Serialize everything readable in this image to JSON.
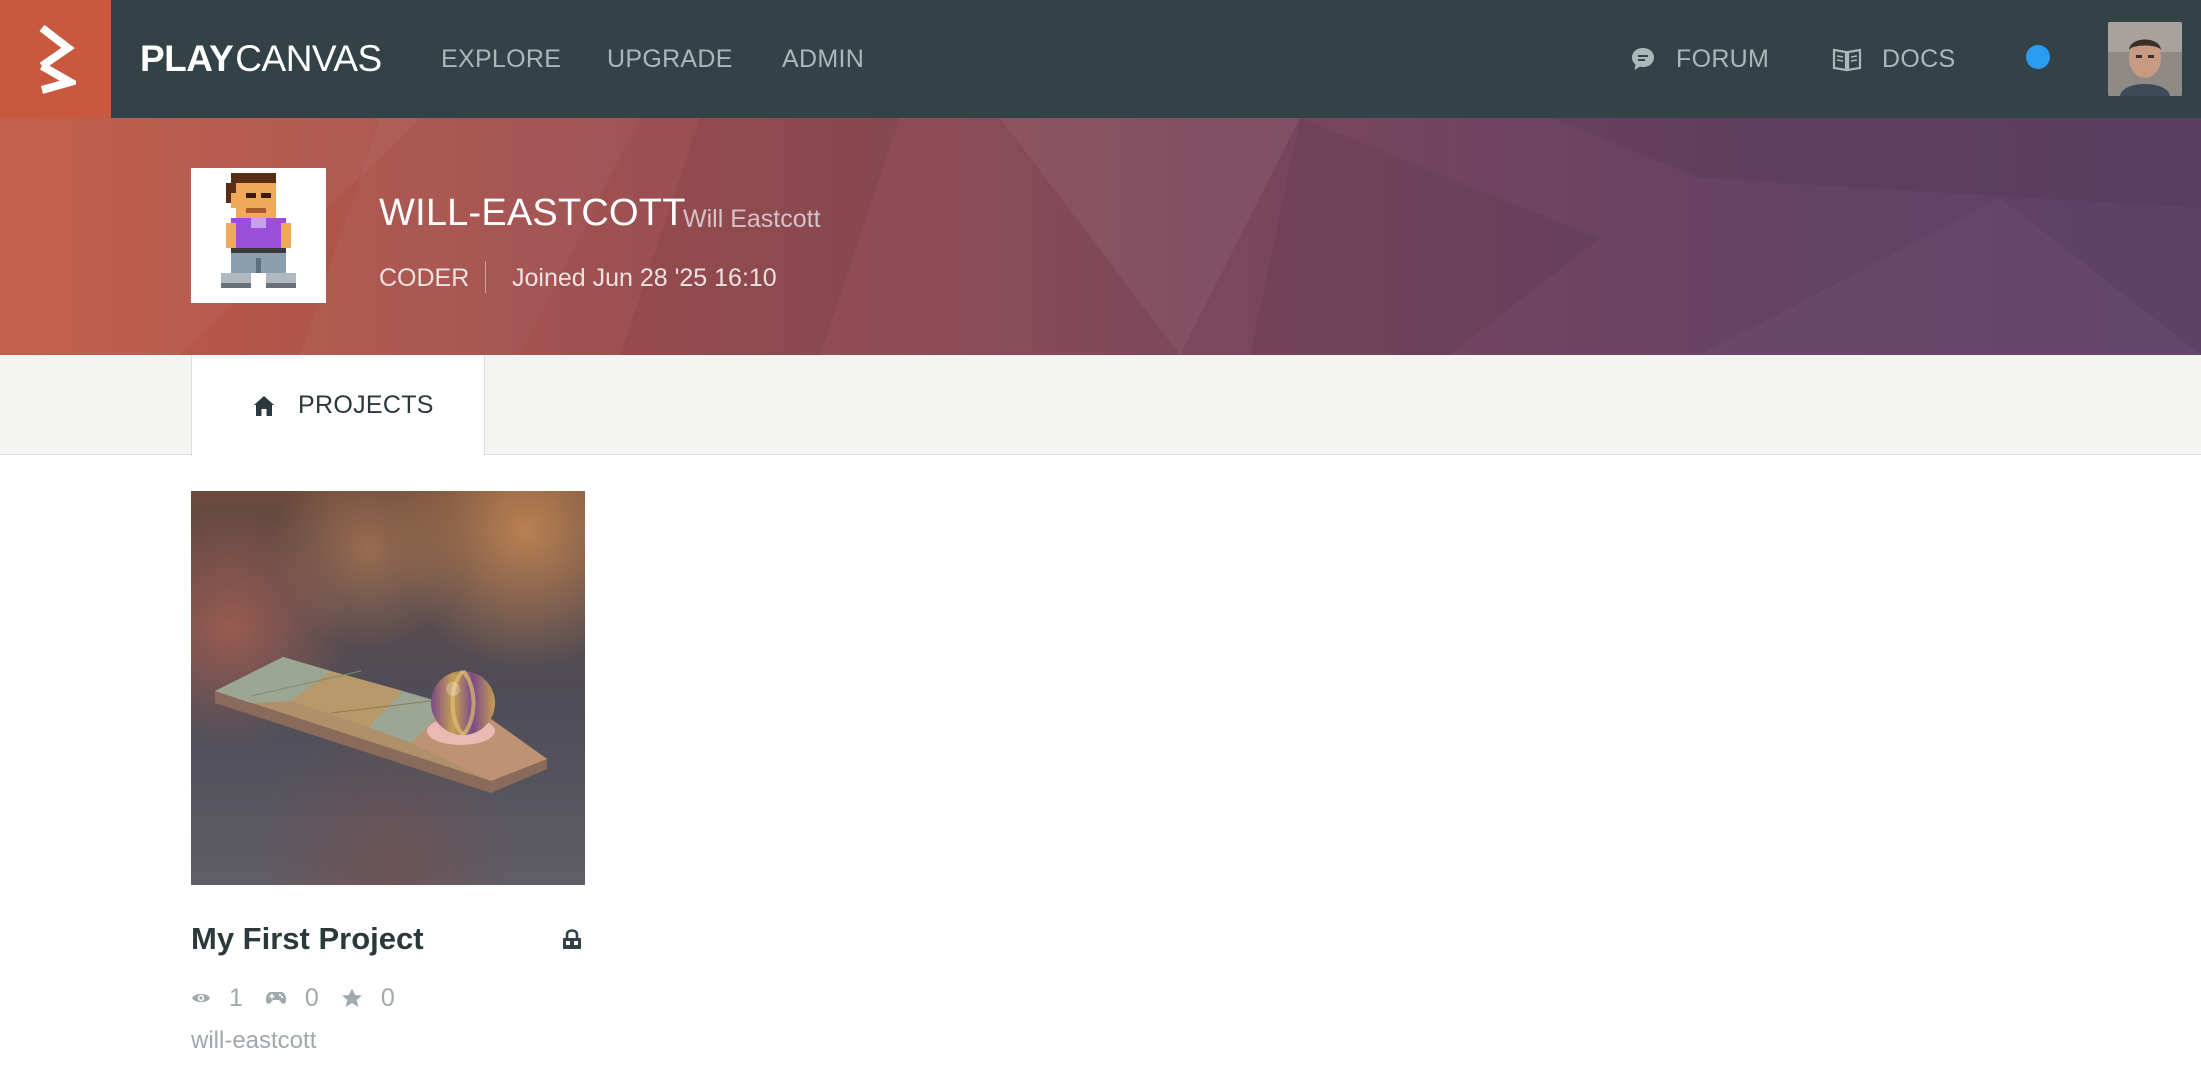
{
  "brand": {
    "name_bold": "PLAY",
    "name_light": "CANVAS"
  },
  "nav": {
    "explore": "EXPLORE",
    "upgrade": "UPGRADE",
    "admin": "ADMIN",
    "forum": "FORUM",
    "docs": "DOCS"
  },
  "colors": {
    "accent": "#c9583f",
    "nav_bg": "#324247",
    "status_dot": "#2a9bf0"
  },
  "profile": {
    "username": "WILL-EASTCOTT",
    "full_name": "Will Eastcott",
    "role": "CODER",
    "joined": "Joined Jun 28 '25 16:10"
  },
  "tabs": [
    {
      "label": "PROJECTS",
      "icon": "home-icon",
      "active": true
    }
  ],
  "projects": [
    {
      "title": "My First Project",
      "views": "1",
      "plays": "0",
      "stars": "0",
      "owner": "will-eastcott",
      "private_icon": "lock-icon"
    }
  ]
}
